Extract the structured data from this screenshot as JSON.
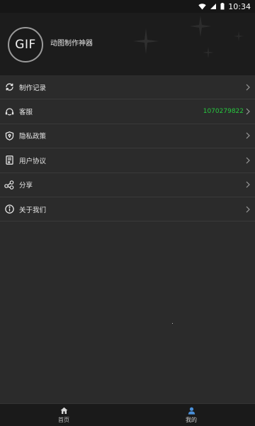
{
  "status_bar": {
    "time": "10:34"
  },
  "profile": {
    "avatar_text": "GIF",
    "app_name": "动图制作神器"
  },
  "menu": {
    "items": [
      {
        "label": "制作记录",
        "icon": "refresh-icon",
        "value": ""
      },
      {
        "label": "客服",
        "icon": "headset-icon",
        "value": "1070279822"
      },
      {
        "label": "隐私政策",
        "icon": "shield-icon",
        "value": ""
      },
      {
        "label": "用户协议",
        "icon": "document-icon",
        "value": ""
      },
      {
        "label": "分享",
        "icon": "share-icon",
        "value": ""
      },
      {
        "label": "关于我们",
        "icon": "info-icon",
        "value": ""
      }
    ]
  },
  "tabs": [
    {
      "label": "首页",
      "icon": "home-icon",
      "active": false
    },
    {
      "label": "我的",
      "icon": "person-icon",
      "active": true
    }
  ],
  "colors": {
    "accent_green": "#27c93f",
    "active_tab_icon": "#4a90d9",
    "background": "#2b2b2b"
  }
}
